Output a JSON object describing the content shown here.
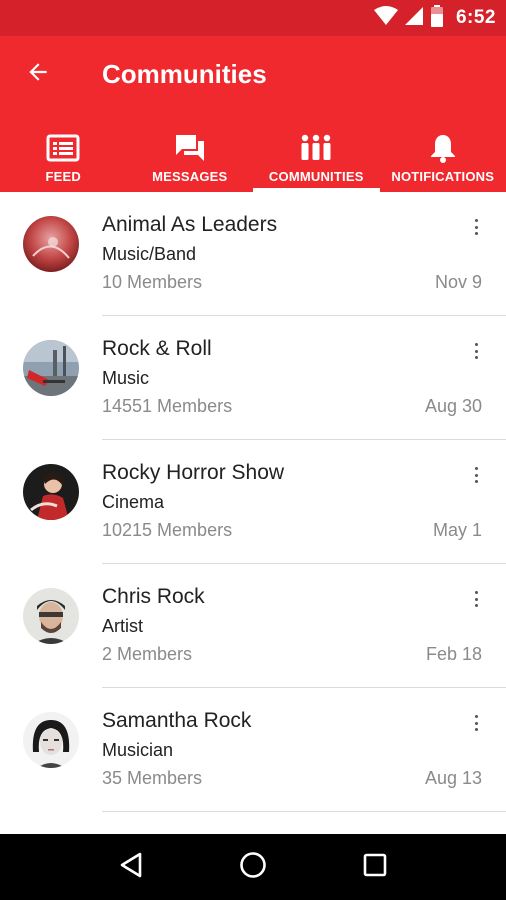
{
  "status_bar": {
    "time": "6:52"
  },
  "app_bar": {
    "title": "Communities"
  },
  "tabs": [
    {
      "label": "FEED",
      "icon": "feed-icon"
    },
    {
      "label": "MESSAGES",
      "icon": "messages-icon"
    },
    {
      "label": "COMMUNITIES",
      "icon": "communities-icon",
      "active": true
    },
    {
      "label": "NOTIFICATIONS",
      "icon": "bell-icon"
    }
  ],
  "communities": [
    {
      "title": "Animal As Leaders",
      "category": "Music/Band",
      "members": "10 Members",
      "date": "Nov 9"
    },
    {
      "title": "Rock & Roll",
      "category": "Music",
      "members": "14551 Members",
      "date": "Aug 30"
    },
    {
      "title": "Rocky Horror Show",
      "category": "Cinema",
      "members": "10215 Members",
      "date": "May 1"
    },
    {
      "title": "Chris Rock",
      "category": "Artist",
      "members": "2 Members",
      "date": "Feb 18"
    },
    {
      "title": "Samantha Rock",
      "category": "Musician",
      "members": "35 Members",
      "date": "Aug 13"
    }
  ],
  "colors": {
    "primary": "#f0292f",
    "status_bar": "#d4212a",
    "secondary_text": "#8a8a8a"
  }
}
